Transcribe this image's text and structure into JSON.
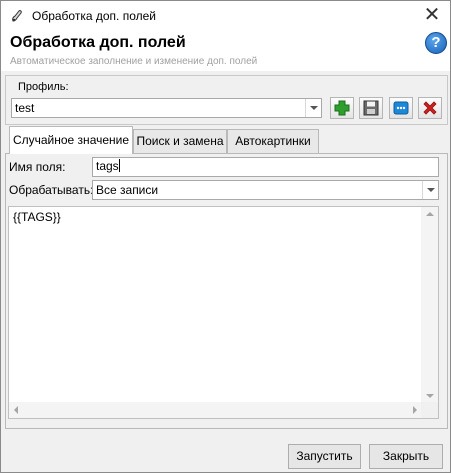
{
  "window": {
    "title": "Обработка доп. полей",
    "close_glyph": "✕",
    "close_icon": "close-icon",
    "app_icon": "paint-tool-icon"
  },
  "header": {
    "title": "Обработка доп. полей",
    "subtitle": "Автоматическое заполнение и изменение доп. полей",
    "help_glyph": "?",
    "help_icon": "help-icon"
  },
  "profile": {
    "label": "Профиль:",
    "value": "test",
    "toolbar": [
      {
        "name": "add-profile-button",
        "icon": "add-icon"
      },
      {
        "name": "save-profile-button",
        "icon": "floppy-disk-icon"
      },
      {
        "name": "rename-profile-button",
        "icon": "dots-icon"
      },
      {
        "name": "delete-profile-button",
        "icon": "delete-icon"
      }
    ]
  },
  "tabs": [
    {
      "label": "Случайное значение",
      "active": true
    },
    {
      "label": "Поиск и замена",
      "active": false
    },
    {
      "label": "Автокартинки",
      "active": false
    }
  ],
  "form": {
    "field_name_label": "Имя поля:",
    "field_name_value": "tags",
    "process_label": "Обрабатывать:",
    "process_value": "Все записи",
    "memo_text": "{{TAGS}}"
  },
  "footer": {
    "run_label": "Запустить",
    "close_label": "Закрыть"
  },
  "colors": {
    "help_blue": "#1a5fb5",
    "add_green": "#2e9e2e",
    "delete_red": "#d12020",
    "rename_blue": "#1e88d8",
    "subtitle_gray": "#a0a0a0"
  }
}
